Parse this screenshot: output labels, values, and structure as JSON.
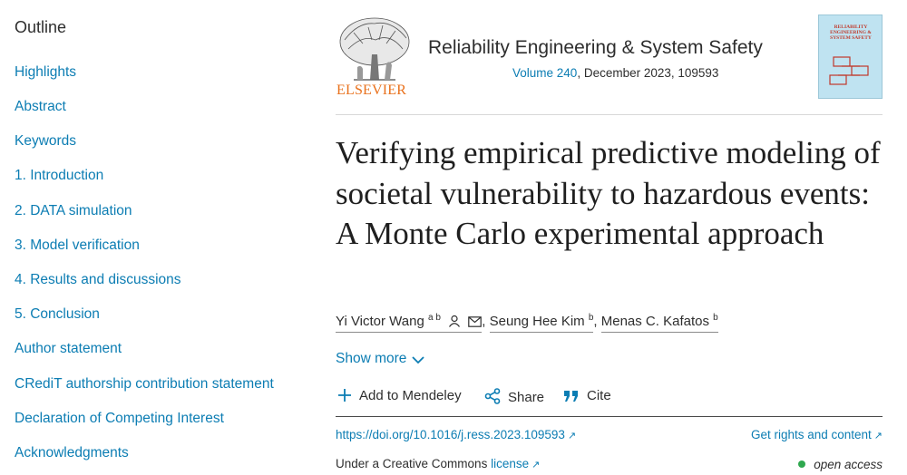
{
  "sidebar": {
    "title": "Outline",
    "items": [
      {
        "label": "Highlights"
      },
      {
        "label": "Abstract"
      },
      {
        "label": "Keywords"
      },
      {
        "label": "1. Introduction"
      },
      {
        "label": "2. DATA simulation"
      },
      {
        "label": "3. Model verification"
      },
      {
        "label": "4. Results and discussions"
      },
      {
        "label": "5. Conclusion"
      },
      {
        "label": "Author statement"
      },
      {
        "label": "CRediT authorship contribution statement"
      },
      {
        "label": "Declaration of Competing Interest"
      },
      {
        "label": "Acknowledgments"
      }
    ]
  },
  "header": {
    "publisher": "ELSEVIER",
    "journal": "Reliability Engineering & System Safety",
    "volume": "Volume 240",
    "issue_rest": ", December 2023, 109593",
    "cover_text": "RELIABILITY ENGINEERING & SYSTEM SAFETY"
  },
  "article": {
    "title": "Verifying empirical predictive modeling of societal vulnerability to hazardous events: A Monte Carlo experimental approach",
    "authors": [
      {
        "name": "Yi Victor Wang",
        "sup": "a b",
        "icons": [
          "person-icon",
          "mail-icon"
        ]
      },
      {
        "name": "Seung Hee Kim",
        "sup": "b"
      },
      {
        "name": "Menas C. Kafatos",
        "sup": "b"
      }
    ],
    "separator": ", ",
    "show_more": "Show more"
  },
  "actions": {
    "mendeley": "Add to Mendeley",
    "share": "Share",
    "cite": "Cite"
  },
  "footer": {
    "doi": "https://doi.org/10.1016/j.ress.2023.109593",
    "rights": "Get rights and content",
    "license_prefix": "Under a Creative Commons ",
    "license_link": "license",
    "access": "open access"
  },
  "colors": {
    "link": "#0c7db3",
    "publisher_orange": "#e9711c",
    "open_access_dot": "#2fa84f"
  }
}
